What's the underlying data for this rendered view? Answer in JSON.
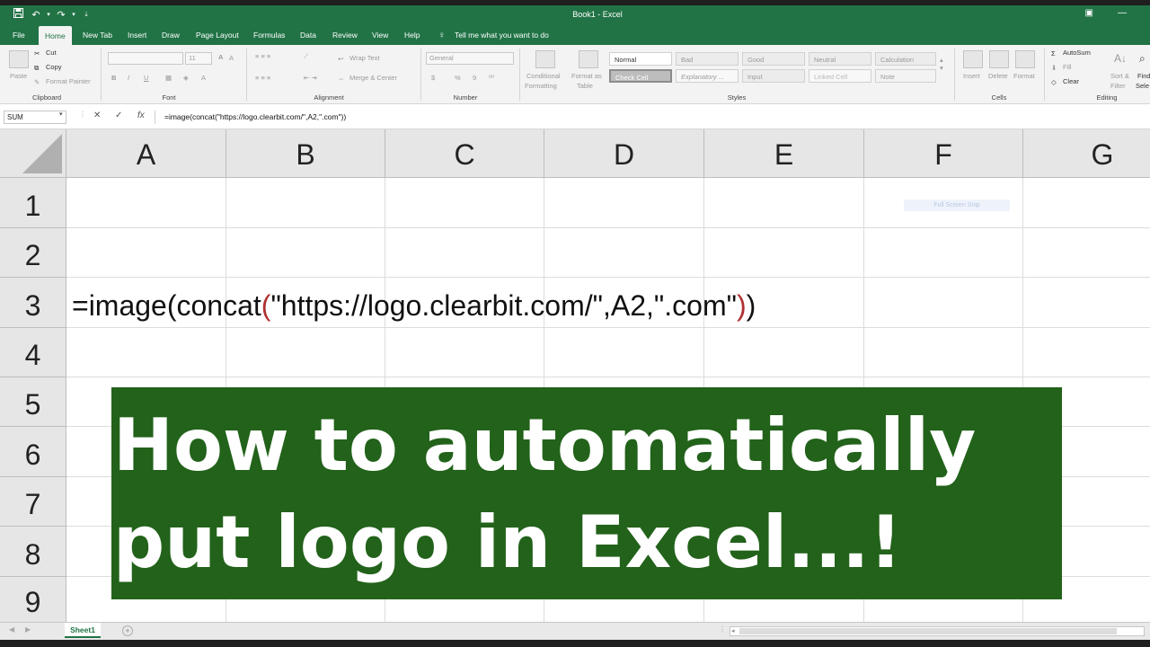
{
  "app": {
    "title": "Book1  -  Excel",
    "accent": "#217346"
  },
  "qat": {
    "save_icon": "save-icon",
    "undo_icon": "undo-icon",
    "redo_icon": "redo-icon",
    "more_icon": "chevron-down-icon"
  },
  "tabs": [
    {
      "label": "File"
    },
    {
      "label": "Home"
    },
    {
      "label": "New Tab"
    },
    {
      "label": "Insert"
    },
    {
      "label": "Draw"
    },
    {
      "label": "Page Layout"
    },
    {
      "label": "Formulas"
    },
    {
      "label": "Data"
    },
    {
      "label": "Review"
    },
    {
      "label": "View"
    },
    {
      "label": "Help"
    },
    {
      "label": "Tell me what you want to do"
    }
  ],
  "ribbon": {
    "clipboard": {
      "paste": "Paste",
      "cut": "Cut",
      "copy": "Copy",
      "format_painter": "Format Painter",
      "label": "Clipboard"
    },
    "font": {
      "size": "11",
      "bold": "B",
      "italic": "I",
      "underline": "U",
      "label": "Font"
    },
    "alignment": {
      "wrap_text": "Wrap Text",
      "merge_center": "Merge & Center",
      "label": "Alignment"
    },
    "number": {
      "format": "General",
      "currency": "$",
      "percent": "%",
      "comma": "9",
      "label": "Number"
    },
    "styles": {
      "conditional": "Conditional",
      "formatting": "Formatting",
      "format_as": "Format as",
      "table": "Table",
      "cells": [
        "Normal",
        "Bad",
        "Good",
        "Neutral",
        "Calculation",
        "Check Cell",
        "Explanatory ...",
        "Input",
        "Linked Cell",
        "Note"
      ],
      "label": "Styles"
    },
    "cells": {
      "insert": "Insert",
      "delete": "Delete",
      "format": "Format",
      "label": "Cells"
    },
    "editing": {
      "autosum": "AutoSum",
      "fill": "Fill",
      "clear": "Clear",
      "sort": "Sort &",
      "filter": "Filter",
      "find": "Find",
      "select": "Sele",
      "label": "Editing"
    }
  },
  "formula_bar": {
    "name_box": "SUM",
    "cancel": "✕",
    "enter": "✓",
    "fx": "fx",
    "formula": "=image(concat(\"https://logo.clearbit.com/\",A2,\".com\"))"
  },
  "grid": {
    "columns": [
      "A",
      "B",
      "C",
      "D",
      "E",
      "F",
      "G"
    ],
    "rows": [
      "1",
      "2",
      "3",
      "4",
      "5",
      "6",
      "7",
      "8",
      "9"
    ],
    "cell_a3": {
      "pre": "=image(concat",
      "open_paren": "(",
      "args": "\"https://logo.clearbit.com/\",A2,\".com\"",
      "close_paren": ")",
      "tail": ")"
    },
    "screenshot_button": "Full Screen Snip"
  },
  "banner": {
    "line1": "How to automatically",
    "line2": "put logo in Excel...!",
    "color": "#22621a"
  },
  "sheets": [
    {
      "label": "Sheet1"
    }
  ],
  "add_sheet": "+"
}
